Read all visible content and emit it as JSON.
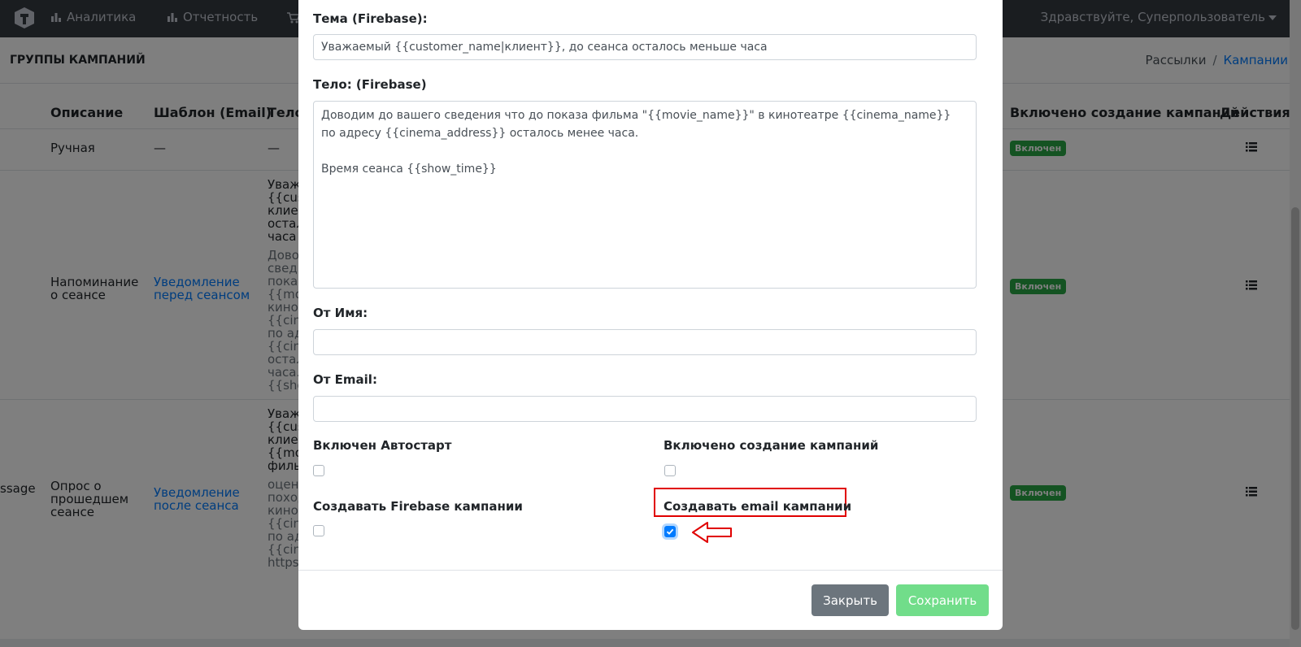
{
  "topbar": {
    "nav": [
      "Аналитика",
      "Отчетность"
    ],
    "greeting": "Здравствуйте, Суперпользователь"
  },
  "header": {
    "title": "ГРУППЫ КАМПАНИЙ",
    "breadcrumb": [
      "Рассылки",
      "/",
      "Кампании"
    ]
  },
  "table": {
    "headers": {
      "description": "Описание",
      "template": "Шаблон (Email)",
      "body": "Тело",
      "enabled_creation": "Включено создание кампаний",
      "actions": "Действия"
    },
    "rows": [
      {
        "description": "Ручная",
        "template": "—",
        "body": "—",
        "status": "Включен"
      },
      {
        "description": "Напоминание о сеансе",
        "template": "Уведомление перед сеансом",
        "body_title": "Уваж\n{{cus\nклиен\nостал\nчаса",
        "body_text": "Дово\nсвед\nпоказ\n{{mov\nкинот\n{{cine\nпо ад\n{{cine\nостал\nчаса.\n{{sho",
        "status": "Включен"
      },
      {
        "prefix": "ssage",
        "description": "Опрос о прошедшем сеансе",
        "template": "Уведомление после сеанса",
        "body_title": "Уваж\n{{cus\nклиен\n{{mov\nфиль",
        "body_text": "оцен\nпоход\nкинот\n{{cine\nпо ад\n{{cine\nhttps",
        "status": "Включен"
      }
    ]
  },
  "modal": {
    "subject_label": "Тема (Firebase):",
    "subject_value": "Уважаемый {{customer_name|клиент}}, до сеанса осталось меньше часа",
    "body_label": "Тело: (Firebase)",
    "body_value": "Доводим до вашего сведения что до показа фильма \"{{movie_name}}\" в кинотеатре {{cinema_name}} по адресу {{cinema_address}} осталось менее часа.\n\nВремя сеанса {{show_time}}",
    "from_name_label": "От Имя:",
    "from_name_value": "",
    "from_email_label": "От Email:",
    "from_email_value": "",
    "autostart_label": "Включен Автостарт",
    "autostart_checked": false,
    "campaign_creation_label": "Включено создание кампаний",
    "campaign_creation_checked": false,
    "firebase_campaigns_label": "Создавать Firebase кампании",
    "firebase_campaigns_checked": false,
    "email_campaigns_label": "Создавать email кампании",
    "email_campaigns_checked": true,
    "close_button": "Закрыть",
    "save_button": "Сохранить"
  },
  "colors": {
    "highlight": "#e00000",
    "primary": "#007bff",
    "success": "#28a745"
  }
}
